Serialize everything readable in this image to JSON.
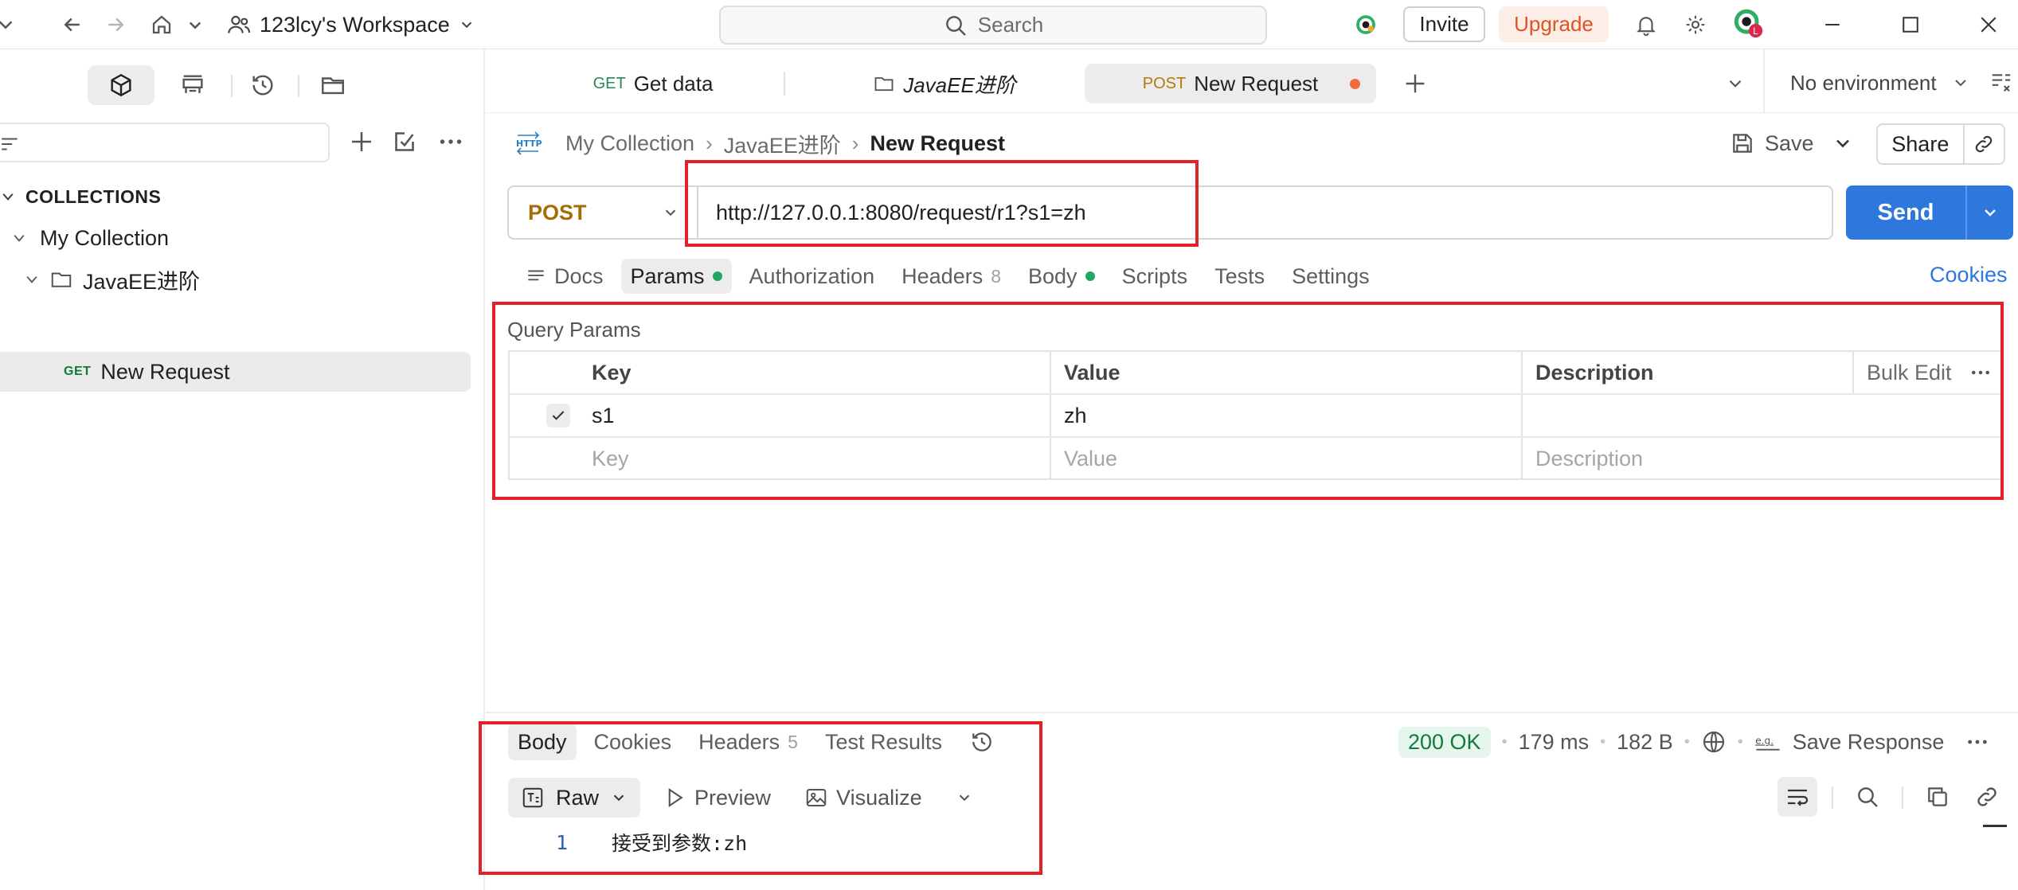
{
  "titlebar": {
    "workspace": "123lcy's Workspace",
    "search_placeholder": "Search",
    "invite": "Invite",
    "upgrade": "Upgrade"
  },
  "sidebar": {
    "collections_heading": "COLLECTIONS",
    "collection_name": "My Collection",
    "folder_name": "JavaEE进阶",
    "request_method": "GET",
    "request_name": "New Request"
  },
  "tabs": [
    {
      "method": "GET",
      "label": "Get data"
    },
    {
      "label": "JavaEE进阶"
    },
    {
      "method": "POST",
      "label": "New Request"
    }
  ],
  "environment": "No environment",
  "request": {
    "breadcrumb": [
      "My Collection",
      "JavaEE进阶",
      "New Request"
    ],
    "save_label": "Save",
    "share_label": "Share",
    "method": "POST",
    "url": "http://127.0.0.1:8080/request/r1?s1=zh",
    "send_label": "Send",
    "tabs": [
      {
        "label": "Docs"
      },
      {
        "label": "Params"
      },
      {
        "label": "Authorization"
      },
      {
        "label": "Headers",
        "count": "8"
      },
      {
        "label": "Body"
      },
      {
        "label": "Scripts"
      },
      {
        "label": "Tests"
      },
      {
        "label": "Settings"
      }
    ],
    "cookies_link": "Cookies"
  },
  "params": {
    "heading": "Query Params",
    "columns": {
      "key": "Key",
      "value": "Value",
      "description": "Description",
      "bulk_edit": "Bulk Edit"
    },
    "rows": [
      {
        "key": "s1",
        "value": "zh",
        "description": "",
        "checked": true
      }
    ],
    "placeholders": {
      "key": "Key",
      "value": "Value",
      "description": "Description"
    }
  },
  "response": {
    "tabs": [
      {
        "label": "Body"
      },
      {
        "label": "Cookies"
      },
      {
        "label": "Headers",
        "count": "5"
      },
      {
        "label": "Test Results"
      }
    ],
    "status": "200 OK",
    "time": "179 ms",
    "size": "182 B",
    "save_response": "Save Response",
    "formats": {
      "raw": "Raw",
      "preview": "Preview",
      "visualize": "Visualize"
    },
    "lines": [
      {
        "number": "1",
        "text": "接受到参数:zh"
      }
    ]
  },
  "colors": {
    "accent": "#2d77dd",
    "annotation": "#e3212b",
    "upgrade": "#e05320",
    "post_method": "#a66d06",
    "status_ok": "#127a3e"
  }
}
